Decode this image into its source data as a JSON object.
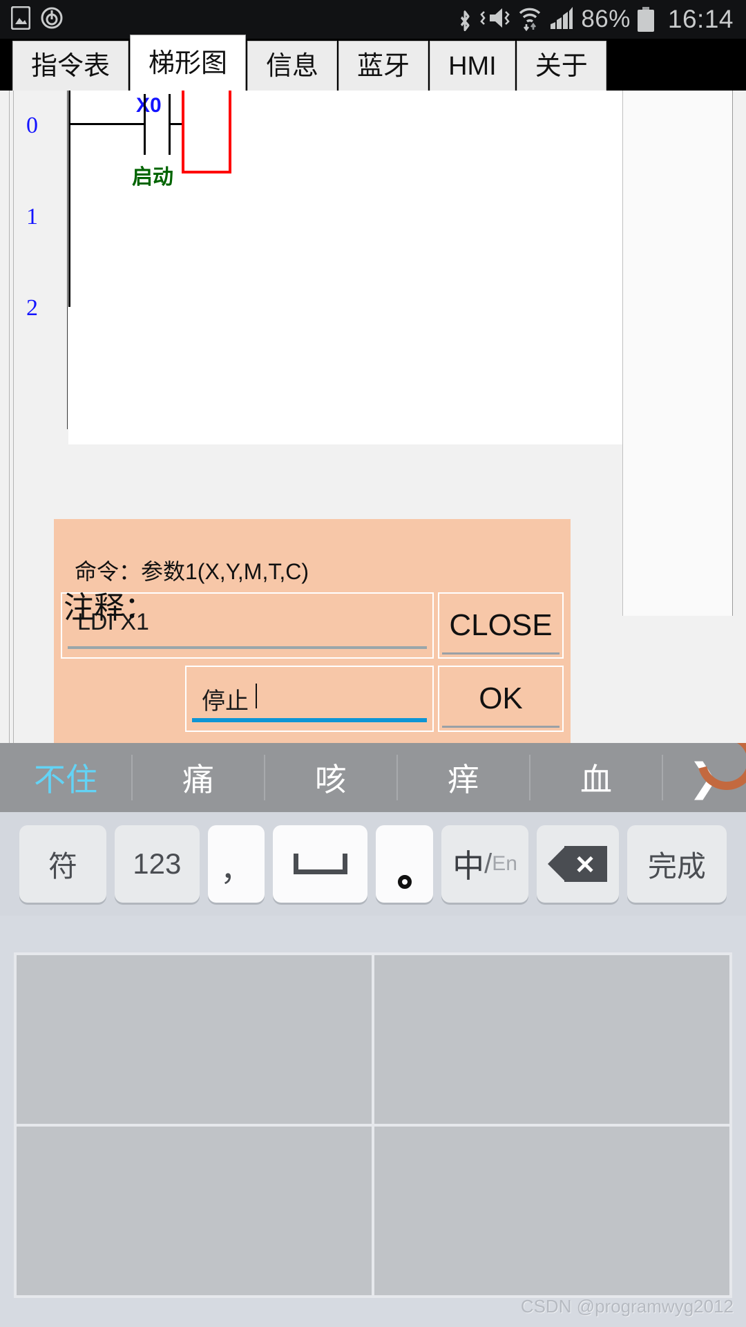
{
  "statusbar": {
    "icons_left": [
      "screenshot-icon",
      "power-saving-icon"
    ],
    "icons_right": [
      "bluetooth-icon",
      "mute-vibrate-icon",
      "wifi-icon",
      "cellular-signal-icon"
    ],
    "battery_percent": "86%",
    "time": "16:14"
  },
  "tabs": [
    {
      "label": "指令表",
      "active": false
    },
    {
      "label": "梯形图",
      "active": true
    },
    {
      "label": "信息",
      "active": false
    },
    {
      "label": "蓝牙",
      "active": false
    },
    {
      "label": "HMI",
      "active": false
    },
    {
      "label": "关于",
      "active": false
    }
  ],
  "ladder": {
    "rung_numbers": [
      "0",
      "1",
      "2"
    ],
    "elements": [
      {
        "type": "contact-no",
        "address": "X0",
        "comment": "启动"
      }
    ],
    "selection_box": "empty-cell-selection",
    "colors": {
      "address": "#1414ff",
      "comment": "#006400",
      "selection": "#ff0000"
    }
  },
  "dialog": {
    "title": "命令：参数1(X,Y,M,T,C)",
    "command_value": "LDI X1",
    "comment_label": "注释：",
    "comment_value": "停止",
    "close_label": "CLOSE",
    "ok_label": "OK",
    "background_color": "#f7c7a8"
  },
  "ime": {
    "candidates": [
      "不住",
      "痛",
      "咳",
      "痒",
      "血"
    ],
    "selected_index": 0,
    "more_icon": "chevron-right-icon",
    "logo_icon": "sogou-logo-icon",
    "keys": [
      {
        "name": "symbol-key",
        "label": "符",
        "style": "normal"
      },
      {
        "name": "numeric-key",
        "label": "123",
        "style": "normal"
      },
      {
        "name": "comma-key",
        "label": "，",
        "style": "light"
      },
      {
        "name": "space-key",
        "label": "",
        "icon": "space-icon",
        "style": "light"
      },
      {
        "name": "period-key",
        "label": "",
        "icon": "period-circle-icon",
        "style": "light"
      },
      {
        "name": "language-toggle-key",
        "label": "中/En",
        "cn": "中",
        "sep": "/",
        "en": "En",
        "style": "normal"
      },
      {
        "name": "backspace-key",
        "label": "",
        "icon": "backspace-icon",
        "style": "normal"
      },
      {
        "name": "done-key",
        "label": "完成",
        "style": "normal"
      }
    ]
  },
  "grid_panel": {
    "cells": [
      "",
      "",
      "",
      ""
    ]
  },
  "watermark": "CSDN @programwyg2012"
}
